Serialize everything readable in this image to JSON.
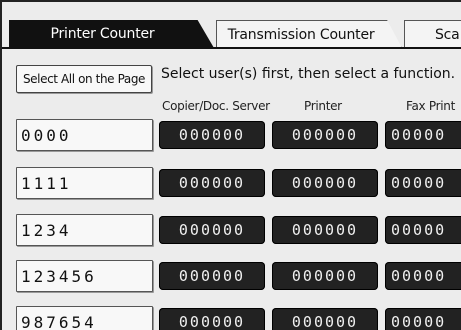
{
  "tabs": [
    {
      "label": "Printer Counter",
      "active": true
    },
    {
      "label": "Transmission Counter",
      "active": false
    },
    {
      "label": "Sca",
      "active": false
    }
  ],
  "toolbar": {
    "select_all_label": "Select All on the Page",
    "instruction": "Select user(s) first, then select a function."
  },
  "columns": [
    "Copier/Doc. Server",
    "Printer",
    "Fax Print"
  ],
  "rows": [
    {
      "user": "0000",
      "copier": "000000",
      "printer": "000000",
      "fax": "00000"
    },
    {
      "user": "1111",
      "copier": "000000",
      "printer": "000000",
      "fax": "00000"
    },
    {
      "user": "1234",
      "copier": "000000",
      "printer": "000000",
      "fax": "00000"
    },
    {
      "user": "123456",
      "copier": "000000",
      "printer": "000000",
      "fax": "00000"
    },
    {
      "user": "987654",
      "copier": "000000",
      "printer": "000000",
      "fax": "00000"
    }
  ]
}
